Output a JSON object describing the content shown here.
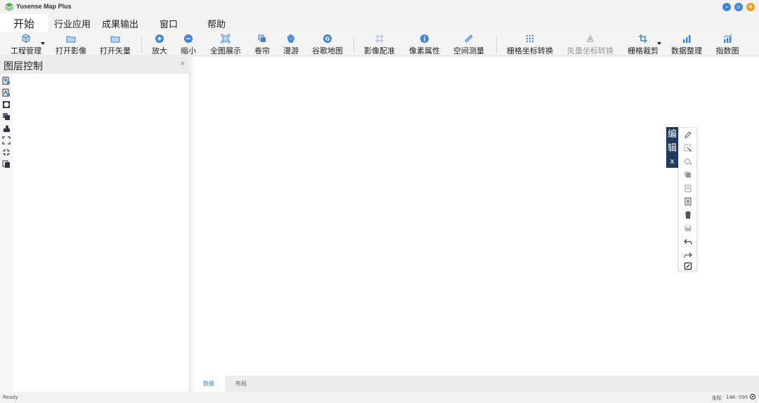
{
  "app": {
    "title": "Yusense Map Plus",
    "accent": "#3f86d9",
    "close_color": "#f0a020"
  },
  "menu": {
    "tabs": [
      {
        "label": "开始",
        "active": true
      },
      {
        "label": "行业应用"
      },
      {
        "label": "成果输出"
      },
      {
        "label": "窗口"
      },
      {
        "label": "帮助"
      }
    ]
  },
  "toolbar": {
    "items": [
      {
        "label": "工程管理",
        "icon": "cube-icon",
        "dropdown": true
      },
      {
        "label": "打开影像",
        "icon": "folder-image-icon"
      },
      {
        "label": "打开矢量",
        "icon": "folder-vector-icon"
      },
      {
        "label": "放大",
        "icon": "zoom-in-icon"
      },
      {
        "label": "缩小",
        "icon": "zoom-out-icon"
      },
      {
        "label": "全图展示",
        "icon": "full-extent-icon"
      },
      {
        "label": "卷帘",
        "icon": "swipe-icon"
      },
      {
        "label": "漫游",
        "icon": "pan-hand-icon"
      },
      {
        "label": "谷歌地图",
        "icon": "google-map-icon"
      },
      {
        "label": "影像配准",
        "icon": "registration-icon"
      },
      {
        "label": "像素属性",
        "icon": "info-icon"
      },
      {
        "label": "空间测量",
        "icon": "ruler-icon"
      },
      {
        "label": "栅格坐标转换",
        "icon": "grid-dots-icon"
      },
      {
        "label": "矢量坐标转换",
        "icon": "vector-transform-icon",
        "disabled": true
      },
      {
        "label": "栅格裁剪",
        "icon": "crop-icon",
        "dropdown": true
      },
      {
        "label": "数据整理",
        "icon": "bar-chart-icon"
      },
      {
        "label": "指数图",
        "icon": "index-chart-icon"
      }
    ]
  },
  "layer_panel": {
    "title": "图层控制",
    "close": "×",
    "tools": [
      "add-layer-icon",
      "add-vector-icon",
      "globe-icon",
      "stack-icon",
      "paint-icon",
      "extent-icon",
      "collapse-icon",
      "copy-icon"
    ]
  },
  "edit_widget": {
    "title_line1": "编",
    "title_line2": "辑",
    "close": "x",
    "tools": [
      "pencil-icon",
      "select-arrow-icon",
      "rotate-icon",
      "layers-icon",
      "clipboard-icon",
      "paste-icon",
      "trash-icon",
      "save-icon",
      "undo-icon",
      "redo-icon",
      "edit-box-icon"
    ]
  },
  "bottom_tabs": [
    {
      "label": "数据",
      "active": true
    },
    {
      "label": "布局"
    }
  ],
  "status": {
    "text": "Ready",
    "coord_label": "坐标",
    "coord_value": "146 -595"
  }
}
